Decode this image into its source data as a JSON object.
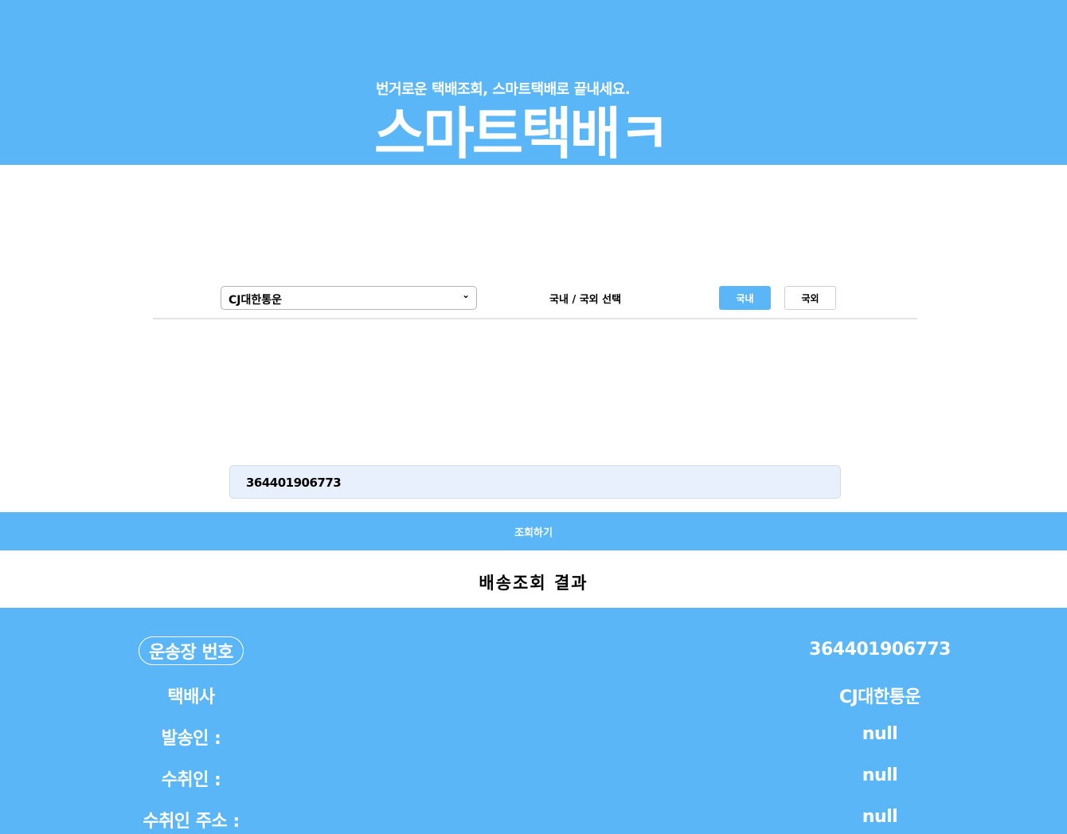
{
  "header": {
    "tagline": "번거로운 택배조회, 스마트택배로 끝내세요.",
    "logo": "스마트택배ㅋ"
  },
  "controls": {
    "carrier_selected": "CJ대한통운",
    "region_label": "국내 / 국외 선택",
    "domestic_label": "국내",
    "international_label": "국외"
  },
  "search": {
    "invoice_value": "364401906773",
    "button_label": "조회하기"
  },
  "result": {
    "title": "배송조회 결과",
    "rows": [
      {
        "label": "운송장 번호",
        "value": "364401906773"
      },
      {
        "label": "택배사",
        "value": "CJ대한통운"
      },
      {
        "label": "발송인 :",
        "value": "null"
      },
      {
        "label": "수취인 :",
        "value": "null"
      },
      {
        "label": "수취인 주소 :",
        "value": "null"
      }
    ]
  },
  "colors": {
    "accent": "#5ab6f6",
    "input_bg": "#e8f0fe"
  }
}
